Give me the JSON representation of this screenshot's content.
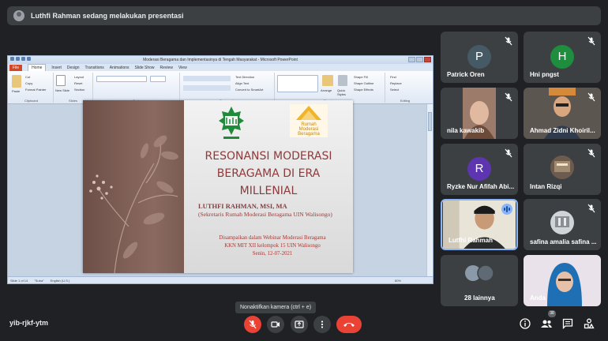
{
  "banner": {
    "text": "Luthfi Rahman sedang melakukan presentasi"
  },
  "ppt": {
    "window_title": "Moderasi Beragama dan Implementasinya di Tengah Masyarakat - Microsoft PowerPoint",
    "tabs": [
      "File",
      "Home",
      "Insert",
      "Design",
      "Transitions",
      "Animations",
      "Slide Show",
      "Review",
      "View"
    ],
    "groups": [
      "Clipboard",
      "Slides",
      "Font",
      "Paragraph",
      "Drawing",
      "Editing"
    ],
    "ribbon_items": {
      "paste": "Paste",
      "cut": "Cut",
      "copy": "Copy",
      "format_painter": "Format Painter",
      "new_slide": "New Slide",
      "layout": "Layout",
      "reset": "Reset",
      "section": "Section",
      "text_direction": "Text Direction",
      "align_text": "Align Text",
      "convert_smartart": "Convert to SmartArt",
      "arrange": "Arrange",
      "quick_styles": "Quick Styles",
      "shape_fill": "Shape Fill",
      "shape_outline": "Shape Outline",
      "shape_effects": "Shape Effects",
      "find": "Find",
      "replace": "Replace",
      "select": "Select"
    },
    "status": {
      "slide": "Slide 1 of 14",
      "theme": "\"Sutra\"",
      "lang": "English (U.S.)",
      "zoom": "80%"
    }
  },
  "slide": {
    "rumah_text": [
      "Rumah",
      "Moderasi",
      "Beragama"
    ],
    "title_lines": [
      "RESONANSI MODERASI",
      "BERAGAMA DI ERA",
      "MILLENIAL"
    ],
    "author": "LUTHFI RAHMAN, MSI, MA",
    "role": "(Sekretaris Rumah Moderasi Beragama UIN Walisongo)",
    "info_lines": [
      "Disampaikan dalam Webinar Moderasi Beragama",
      "KKN MIT XII kelompok 15 UIN Walisongo",
      "Senin, 12-07-2021"
    ]
  },
  "participants": [
    {
      "name": "Patrick Oren",
      "letter": "P",
      "color": "#455a64"
    },
    {
      "name": "Hni pngst",
      "letter": "H",
      "color": "#1e8e3e"
    },
    {
      "name": "nila kawakib"
    },
    {
      "name": "Ahmad Zidni Khoiril..."
    },
    {
      "name": "Ryzke Nur Afifah Abi...",
      "letter": "R",
      "color": "#5e35b1"
    },
    {
      "name": "Intan Rizqi"
    },
    {
      "name": "Lutfhi Rahmah"
    },
    {
      "name": "safina amalia safina ..."
    },
    {
      "name": "28 lainnya"
    },
    {
      "name": "Anda"
    }
  ],
  "bottom": {
    "meeting_code": "yib-rjkf-ytm",
    "tooltip": "Nonaktifkan kamera (ctrl + e)",
    "participant_count": "38"
  },
  "colors": {
    "accent": "#8ab4f8",
    "danger": "#ea4335",
    "surface": "#3c4043",
    "background": "#202124"
  }
}
